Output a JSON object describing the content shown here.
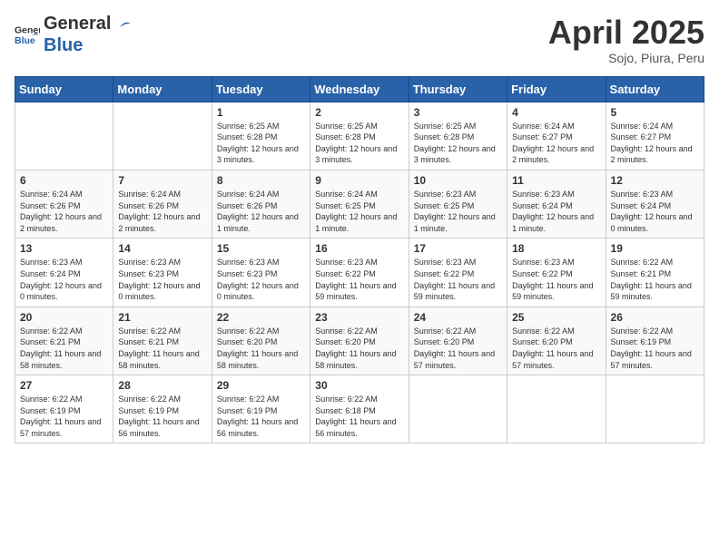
{
  "header": {
    "logo_general": "General",
    "logo_blue": "Blue",
    "month_title": "April 2025",
    "subtitle": "Sojo, Piura, Peru"
  },
  "weekdays": [
    "Sunday",
    "Monday",
    "Tuesday",
    "Wednesday",
    "Thursday",
    "Friday",
    "Saturday"
  ],
  "weeks": [
    [
      {
        "day": "",
        "sunrise": "",
        "sunset": "",
        "daylight": ""
      },
      {
        "day": "",
        "sunrise": "",
        "sunset": "",
        "daylight": ""
      },
      {
        "day": "1",
        "sunrise": "Sunrise: 6:25 AM",
        "sunset": "Sunset: 6:28 PM",
        "daylight": "Daylight: 12 hours and 3 minutes."
      },
      {
        "day": "2",
        "sunrise": "Sunrise: 6:25 AM",
        "sunset": "Sunset: 6:28 PM",
        "daylight": "Daylight: 12 hours and 3 minutes."
      },
      {
        "day": "3",
        "sunrise": "Sunrise: 6:25 AM",
        "sunset": "Sunset: 6:28 PM",
        "daylight": "Daylight: 12 hours and 3 minutes."
      },
      {
        "day": "4",
        "sunrise": "Sunrise: 6:24 AM",
        "sunset": "Sunset: 6:27 PM",
        "daylight": "Daylight: 12 hours and 2 minutes."
      },
      {
        "day": "5",
        "sunrise": "Sunrise: 6:24 AM",
        "sunset": "Sunset: 6:27 PM",
        "daylight": "Daylight: 12 hours and 2 minutes."
      }
    ],
    [
      {
        "day": "6",
        "sunrise": "Sunrise: 6:24 AM",
        "sunset": "Sunset: 6:26 PM",
        "daylight": "Daylight: 12 hours and 2 minutes."
      },
      {
        "day": "7",
        "sunrise": "Sunrise: 6:24 AM",
        "sunset": "Sunset: 6:26 PM",
        "daylight": "Daylight: 12 hours and 2 minutes."
      },
      {
        "day": "8",
        "sunrise": "Sunrise: 6:24 AM",
        "sunset": "Sunset: 6:26 PM",
        "daylight": "Daylight: 12 hours and 1 minute."
      },
      {
        "day": "9",
        "sunrise": "Sunrise: 6:24 AM",
        "sunset": "Sunset: 6:25 PM",
        "daylight": "Daylight: 12 hours and 1 minute."
      },
      {
        "day": "10",
        "sunrise": "Sunrise: 6:23 AM",
        "sunset": "Sunset: 6:25 PM",
        "daylight": "Daylight: 12 hours and 1 minute."
      },
      {
        "day": "11",
        "sunrise": "Sunrise: 6:23 AM",
        "sunset": "Sunset: 6:24 PM",
        "daylight": "Daylight: 12 hours and 1 minute."
      },
      {
        "day": "12",
        "sunrise": "Sunrise: 6:23 AM",
        "sunset": "Sunset: 6:24 PM",
        "daylight": "Daylight: 12 hours and 0 minutes."
      }
    ],
    [
      {
        "day": "13",
        "sunrise": "Sunrise: 6:23 AM",
        "sunset": "Sunset: 6:24 PM",
        "daylight": "Daylight: 12 hours and 0 minutes."
      },
      {
        "day": "14",
        "sunrise": "Sunrise: 6:23 AM",
        "sunset": "Sunset: 6:23 PM",
        "daylight": "Daylight: 12 hours and 0 minutes."
      },
      {
        "day": "15",
        "sunrise": "Sunrise: 6:23 AM",
        "sunset": "Sunset: 6:23 PM",
        "daylight": "Daylight: 12 hours and 0 minutes."
      },
      {
        "day": "16",
        "sunrise": "Sunrise: 6:23 AM",
        "sunset": "Sunset: 6:22 PM",
        "daylight": "Daylight: 11 hours and 59 minutes."
      },
      {
        "day": "17",
        "sunrise": "Sunrise: 6:23 AM",
        "sunset": "Sunset: 6:22 PM",
        "daylight": "Daylight: 11 hours and 59 minutes."
      },
      {
        "day": "18",
        "sunrise": "Sunrise: 6:23 AM",
        "sunset": "Sunset: 6:22 PM",
        "daylight": "Daylight: 11 hours and 59 minutes."
      },
      {
        "day": "19",
        "sunrise": "Sunrise: 6:22 AM",
        "sunset": "Sunset: 6:21 PM",
        "daylight": "Daylight: 11 hours and 59 minutes."
      }
    ],
    [
      {
        "day": "20",
        "sunrise": "Sunrise: 6:22 AM",
        "sunset": "Sunset: 6:21 PM",
        "daylight": "Daylight: 11 hours and 58 minutes."
      },
      {
        "day": "21",
        "sunrise": "Sunrise: 6:22 AM",
        "sunset": "Sunset: 6:21 PM",
        "daylight": "Daylight: 11 hours and 58 minutes."
      },
      {
        "day": "22",
        "sunrise": "Sunrise: 6:22 AM",
        "sunset": "Sunset: 6:20 PM",
        "daylight": "Daylight: 11 hours and 58 minutes."
      },
      {
        "day": "23",
        "sunrise": "Sunrise: 6:22 AM",
        "sunset": "Sunset: 6:20 PM",
        "daylight": "Daylight: 11 hours and 58 minutes."
      },
      {
        "day": "24",
        "sunrise": "Sunrise: 6:22 AM",
        "sunset": "Sunset: 6:20 PM",
        "daylight": "Daylight: 11 hours and 57 minutes."
      },
      {
        "day": "25",
        "sunrise": "Sunrise: 6:22 AM",
        "sunset": "Sunset: 6:20 PM",
        "daylight": "Daylight: 11 hours and 57 minutes."
      },
      {
        "day": "26",
        "sunrise": "Sunrise: 6:22 AM",
        "sunset": "Sunset: 6:19 PM",
        "daylight": "Daylight: 11 hours and 57 minutes."
      }
    ],
    [
      {
        "day": "27",
        "sunrise": "Sunrise: 6:22 AM",
        "sunset": "Sunset: 6:19 PM",
        "daylight": "Daylight: 11 hours and 57 minutes."
      },
      {
        "day": "28",
        "sunrise": "Sunrise: 6:22 AM",
        "sunset": "Sunset: 6:19 PM",
        "daylight": "Daylight: 11 hours and 56 minutes."
      },
      {
        "day": "29",
        "sunrise": "Sunrise: 6:22 AM",
        "sunset": "Sunset: 6:19 PM",
        "daylight": "Daylight: 11 hours and 56 minutes."
      },
      {
        "day": "30",
        "sunrise": "Sunrise: 6:22 AM",
        "sunset": "Sunset: 6:18 PM",
        "daylight": "Daylight: 11 hours and 56 minutes."
      },
      {
        "day": "",
        "sunrise": "",
        "sunset": "",
        "daylight": ""
      },
      {
        "day": "",
        "sunrise": "",
        "sunset": "",
        "daylight": ""
      },
      {
        "day": "",
        "sunrise": "",
        "sunset": "",
        "daylight": ""
      }
    ]
  ]
}
